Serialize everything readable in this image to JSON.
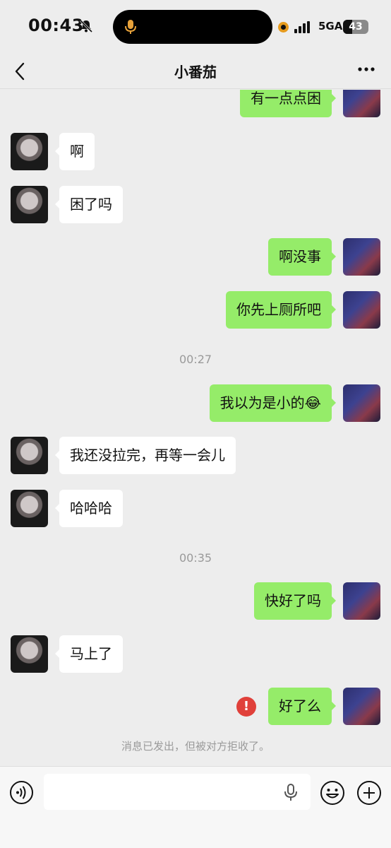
{
  "status_bar": {
    "time": "00:43",
    "network": "5GA",
    "battery": "43",
    "icons": [
      "bell-muted-icon",
      "microphone-icon",
      "record-indicator-icon",
      "signal-icon",
      "battery-icon"
    ]
  },
  "nav": {
    "title": "小番茄",
    "back_icon": "chevron-left-icon",
    "more_icon": "more-dots-icon"
  },
  "chat": {
    "messages": [
      {
        "side": "out",
        "text": "有一点点困"
      },
      {
        "side": "in",
        "text": "啊"
      },
      {
        "side": "in",
        "text": "困了吗"
      },
      {
        "side": "out",
        "text": "啊没事"
      },
      {
        "side": "out",
        "text": "你先上厕所吧"
      },
      {
        "type": "time",
        "text": "00:27"
      },
      {
        "side": "out",
        "text": "我以为是小的😂"
      },
      {
        "side": "in",
        "text": "我还没拉完，再等一会儿"
      },
      {
        "side": "in",
        "text": "哈哈哈"
      },
      {
        "type": "time",
        "text": "00:35"
      },
      {
        "side": "out",
        "text": "快好了吗"
      },
      {
        "side": "in",
        "text": "马上了"
      },
      {
        "side": "out",
        "text": "好了么",
        "failed": true
      },
      {
        "type": "notice",
        "text": "消息已发出，但被对方拒收了。"
      }
    ],
    "error_mark": "!"
  },
  "input_bar": {
    "text_value": "",
    "icons": [
      "voice-icon",
      "microphone-icon",
      "emoji-icon",
      "plus-icon"
    ]
  },
  "colors": {
    "background": "#ededed",
    "outgoing_bubble": "#95ec69",
    "incoming_bubble": "#ffffff",
    "error": "#e0403a"
  }
}
